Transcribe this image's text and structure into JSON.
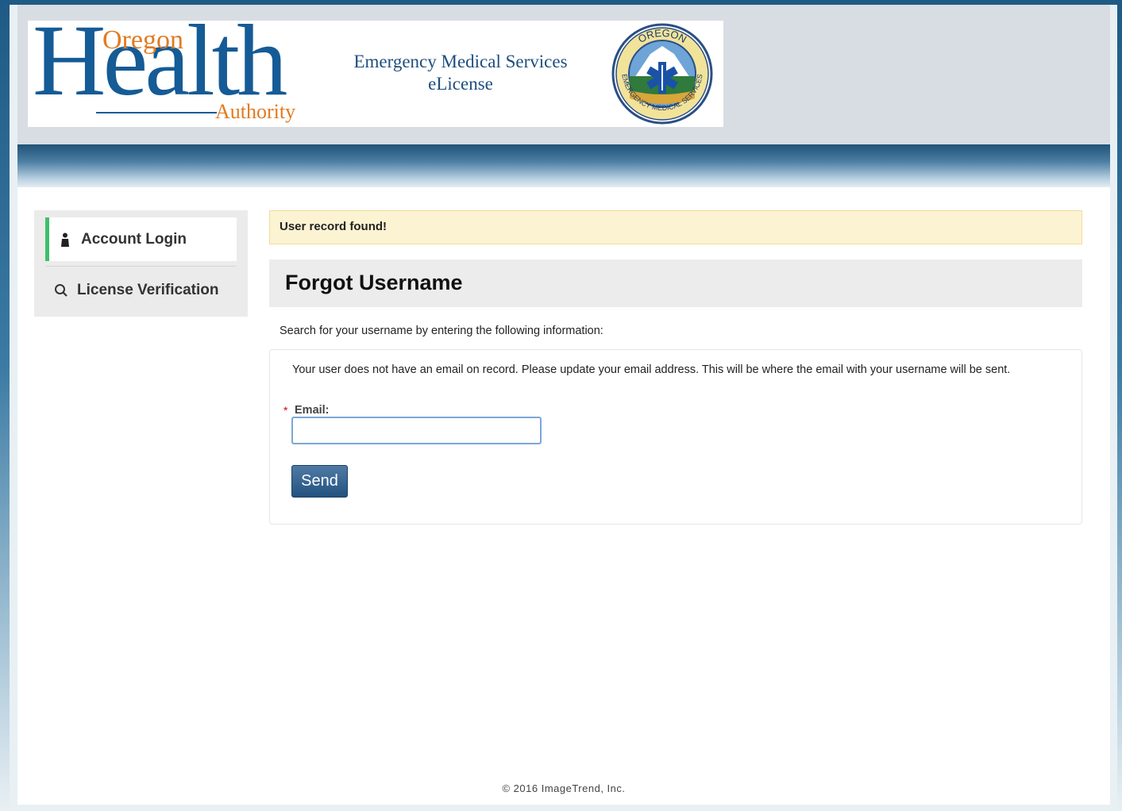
{
  "banner": {
    "logo_oregon": "Oregon",
    "logo_health": "Health",
    "logo_authority": "Authority",
    "title_line1": "Emergency Medical Services",
    "title_line2": "eLicense",
    "seal_top": "OREGON",
    "seal_bottom": "EMERGENCY MEDICAL SERVICES"
  },
  "sidebar": {
    "items": [
      {
        "label": "Account Login",
        "icon": "user-icon",
        "active": true
      },
      {
        "label": "License Verification",
        "icon": "search-icon",
        "active": false
      }
    ]
  },
  "alert": {
    "text": "User record found!"
  },
  "main": {
    "title": "Forgot Username",
    "intro": "Search for your username by entering the following information:",
    "message": "Your user does not have an email on record. Please update your email address. This will be where the email with your username will be sent.",
    "email_label": "Email:",
    "email_value": "",
    "send_label": "Send"
  },
  "footer": {
    "text": "© 2016 ImageTrend, Inc."
  },
  "colors": {
    "brand_blue": "#155b96",
    "brand_orange": "#e07b22",
    "active_indicator": "#3fbf6a",
    "alert_bg": "#fcf3d2",
    "button_blue": "#23527f"
  }
}
